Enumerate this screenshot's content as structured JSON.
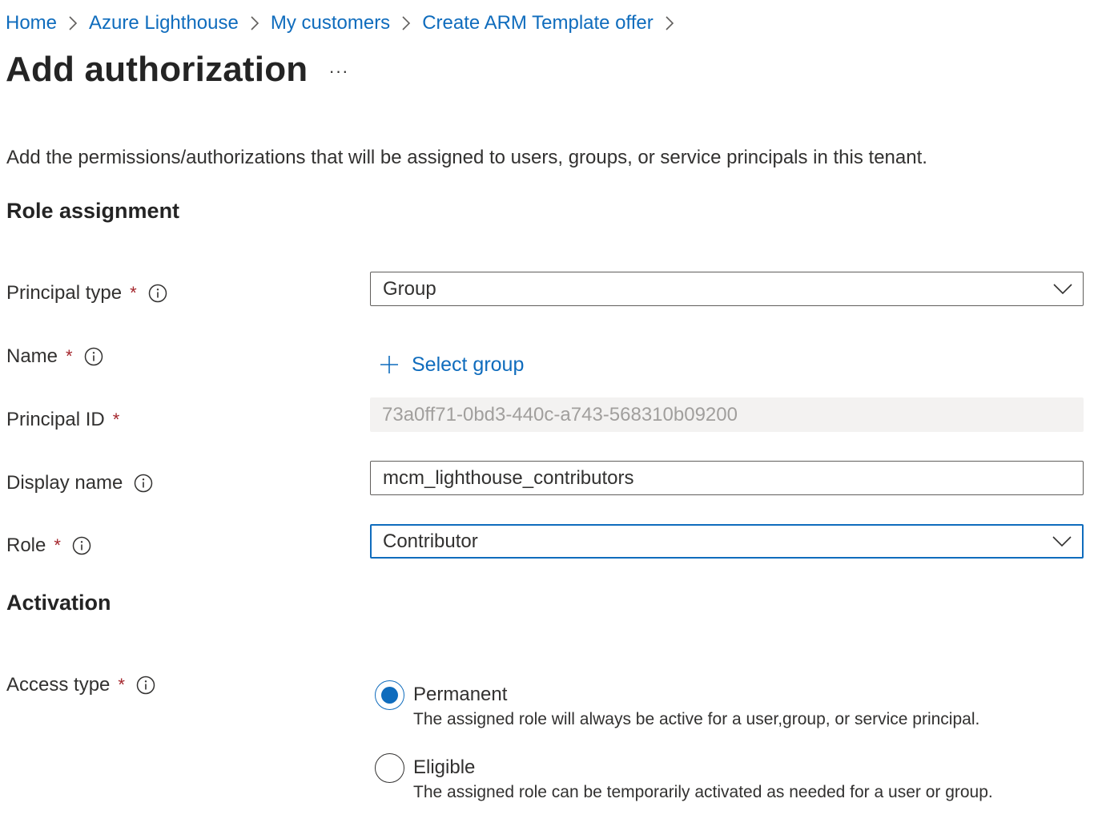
{
  "breadcrumb": [
    "Home",
    "Azure Lighthouse",
    "My customers",
    "Create ARM Template offer"
  ],
  "page": {
    "title": "Add authorization",
    "more_label": "···",
    "description": "Add the permissions/authorizations that will be assigned to users, groups, or service principals in this tenant."
  },
  "sections": {
    "role_assignment": "Role assignment",
    "activation": "Activation"
  },
  "fields": {
    "principal_type": {
      "label": "Principal type",
      "required": "*",
      "value": "Group"
    },
    "name": {
      "label": "Name",
      "required": "*",
      "action": "Select group"
    },
    "principal_id": {
      "label": "Principal ID",
      "required": "*",
      "value": "73a0ff71-0bd3-440c-a743-568310b09200"
    },
    "display_name": {
      "label": "Display name",
      "value": "mcm_lighthouse_contributors"
    },
    "role": {
      "label": "Role",
      "required": "*",
      "value": "Contributor"
    },
    "access_type": {
      "label": "Access type",
      "required": "*",
      "options": [
        {
          "label": "Permanent",
          "description": "The assigned role will always be active for a user,group, or service principal.",
          "selected": true
        },
        {
          "label": "Eligible",
          "description": "The assigned role can be temporarily activated as needed for a user or group.",
          "selected": false
        }
      ]
    }
  },
  "colors": {
    "link": "#0f6cbd",
    "required": "#a4262c",
    "disabled_bg": "#f3f2f1",
    "disabled_text": "#a19f9d"
  },
  "icons": {
    "breadcrumb_separator": "chevron-right-icon",
    "info": "info-icon",
    "dropdown": "chevron-down-icon",
    "add": "plus-icon"
  }
}
